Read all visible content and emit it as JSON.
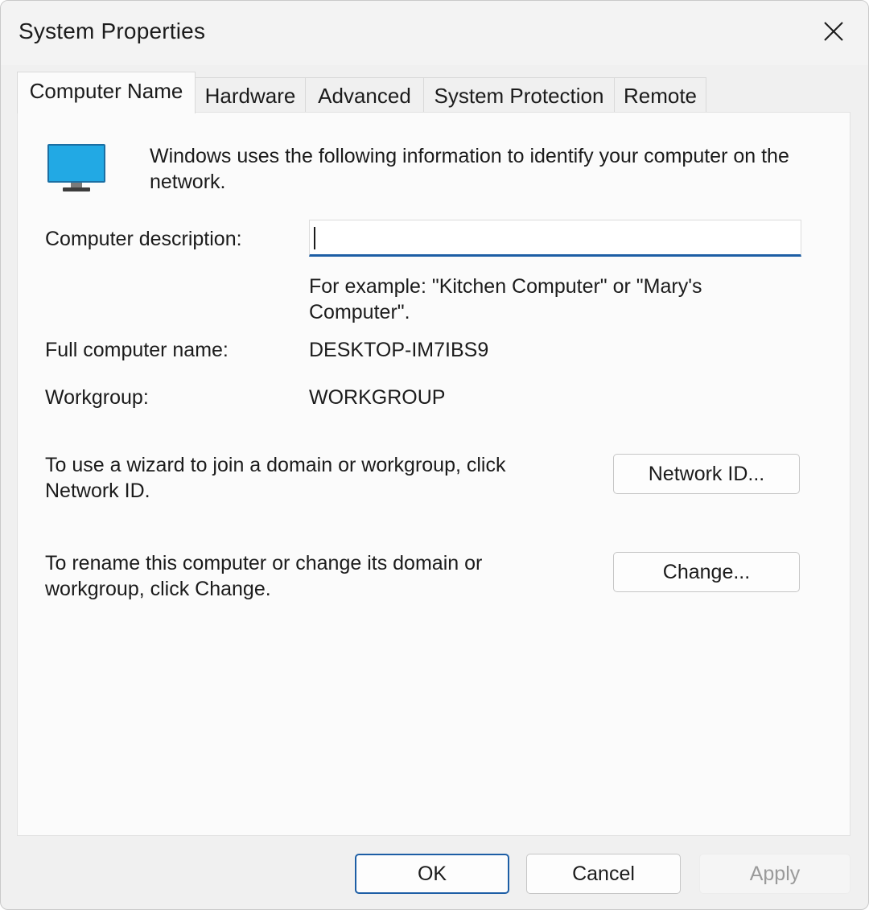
{
  "window": {
    "title": "System Properties"
  },
  "tabs": [
    {
      "label": "Computer Name",
      "active": true
    },
    {
      "label": "Hardware",
      "active": false
    },
    {
      "label": "Advanced",
      "active": false
    },
    {
      "label": "System Protection",
      "active": false
    },
    {
      "label": "Remote",
      "active": false
    }
  ],
  "computer_name": {
    "intro": "Windows uses the following information to identify your computer on the network.",
    "description_label": "Computer description:",
    "description_value": "",
    "example_text": "For example: \"Kitchen Computer\" or \"Mary's Computer\".",
    "full_name_label": "Full computer name:",
    "full_name_value": "DESKTOP-IM7IBS9",
    "workgroup_label": "Workgroup:",
    "workgroup_value": "WORKGROUP",
    "network_id_text": "To use a wizard to join a domain or workgroup, click Network ID.",
    "network_id_button": "Network ID...",
    "change_text": "To rename this computer or change its domain or workgroup, click Change.",
    "change_button": "Change..."
  },
  "footer": {
    "ok_label": "OK",
    "cancel_label": "Cancel",
    "apply_label": "Apply",
    "apply_disabled": true
  },
  "icons": {
    "close": "close-icon",
    "monitor": "monitor-icon"
  },
  "colors": {
    "accent": "#1d5ea5",
    "monitor_screen": "#22a9e4"
  }
}
